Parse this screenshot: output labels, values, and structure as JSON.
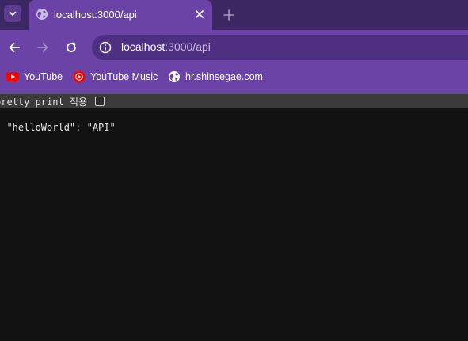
{
  "browser": {
    "tab": {
      "title": "localhost:3000/api",
      "favicon": "globe-icon"
    },
    "toolbar": {
      "url_host": "localhost",
      "url_path": ":3000/api"
    },
    "bookmarks": [
      {
        "label": "YouTube",
        "icon": "youtube-icon"
      },
      {
        "label": "YouTube Music",
        "icon": "youtube-music-icon"
      },
      {
        "label": "hr.shinsegae.com",
        "icon": "globe-icon"
      }
    ],
    "colors": {
      "tabstrip": "#3d2762",
      "toolbar": "#6b43a6",
      "omnibox": "#4e2f82",
      "page_background": "#121212",
      "youtube_red": "#ff0000"
    }
  },
  "page": {
    "pretty_print_label": "pretty print 적용",
    "pretty_print_checked": false,
    "json_lines": {
      "open": "{",
      "entry": "  \"helloWorld\": \"API\"",
      "close": "}"
    }
  }
}
